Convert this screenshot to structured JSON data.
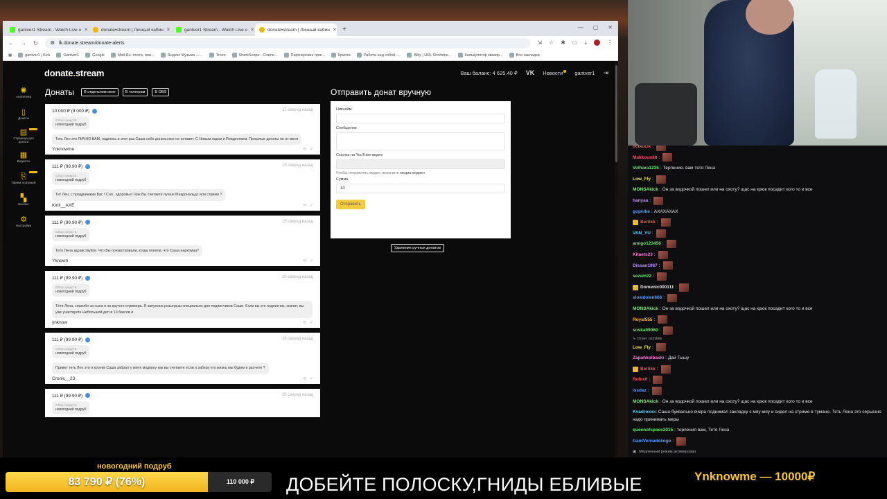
{
  "browser": {
    "tabs": [
      {
        "title": "gantver1 Stream - Watch Live o",
        "fav": "k",
        "active": false
      },
      {
        "title": "donate•stream | Личный кабин",
        "fav": "d",
        "active": false
      },
      {
        "title": "gantver1 Stream - Watch Live o",
        "fav": "k",
        "active": false
      },
      {
        "title": "donate•stream | Личный кабин",
        "fav": "d",
        "active": true
      }
    ],
    "new_tab": "+",
    "url": "lk.donate.stream/donate-alerts",
    "bookmarks": [
      "gantver1 | Kick",
      "Gantver1",
      "Google",
      "Mail.Ru: почта, пои...",
      "Яндекс Музыка —...",
      "Trovo",
      "SharkScope - Crame...",
      "Партнерские прог...",
      "Крипта",
      "Работа над собой -...",
      "Bitly | URL Shortene...",
      "Калькулятор квазор...",
      "Все закладки"
    ]
  },
  "site": {
    "logo_pre": "donate",
    "logo_dot": ".",
    "logo_post": "stream",
    "balance": "Ваш баланс: 4 625.40 ₽",
    "vk": "VK",
    "news": "Новости",
    "user": "gantver1",
    "logout": "⇥"
  },
  "sidebar": [
    {
      "label": "Аналитика",
      "icon": "✺",
      "badge": false
    },
    {
      "label": "Донаты",
      "icon": "▯",
      "badge": false
    },
    {
      "label": "Страница для доната",
      "icon": "▤",
      "badge": true
    },
    {
      "label": "Виджеты",
      "icon": "▦",
      "badge": false
    },
    {
      "label": "Приём платежей",
      "icon": "⎘",
      "badge": true
    },
    {
      "label": "Баланс",
      "icon": "▚",
      "badge": false
    },
    {
      "label": "Настройки",
      "icon": "⚙",
      "badge": false
    }
  ],
  "donations": {
    "title": "Донаты",
    "btn_window": "В отдельном окне",
    "btn_telegram": "В телеграм",
    "btn_obs": "В OBS",
    "items": [
      {
        "amount": "10 000 ₽ (9 000 ₽)",
        "time": "17 секунд назад",
        "goal_label": "Сбор средств",
        "goal": "новогодний подруб",
        "message": "Теть Лен это ЛИЧНО ВАМ, надеюсь в этот раз Саша себе донаты все не оставит. С Новым годом и Рождеством. Прошлые донаты не от меня",
        "name": "Ynknowme"
      },
      {
        "amount": "111 ₽ (99.90 ₽)",
        "time": "15 секунд назад",
        "goal_label": "Сбор средств",
        "goal": "новогодний подруб",
        "message": "Тет Лен, с праздниками Вас ! Сап , здоровья ! Как Вы считаете лучше Макдональдс или стрими ?",
        "name": "Kirill__AXE"
      },
      {
        "amount": "111 ₽ (99.90 ₽)",
        "time": "15 секунд назад",
        "goal_label": "Сбор средств",
        "goal": "новогодний подруб",
        "message": "Тетя Лена здравствуйте. Что Вы почувствовали, когда поняли, что Саша наркоман?",
        "name": "Yknown"
      },
      {
        "amount": "111 ₽ (99.90 ₽)",
        "time": "20 секунд назад",
        "goal_label": "Сбор средств",
        "goal": "новогодний подруб",
        "message": "Тётя Лена, спасибо за сына и за крутого стримера. Я запускаю розыгрыш специально для подписчиков Саши. Если вы его подписчик, значит, вы уже участвуете.Небольшой деп в 10 баксов и",
        "name": "ynknow"
      },
      {
        "amount": "111 ₽ (99.90 ₽)",
        "time": "16 секунд назад",
        "goal_label": "Сбор средств",
        "goal": "новогодний подруб",
        "message": "Привет теть Лен это я кроник Саша забрал у меня модерку как вы считаете если я заберу его жизнь мы будем в расчете ?",
        "name": "Cronic__23"
      },
      {
        "amount": "111 ₽ (99.90 ₽)",
        "time": "20 секунд назад",
        "goal_label": "Сбор средств",
        "goal": "новогодний подруб",
        "message": "",
        "name": ""
      }
    ]
  },
  "manual": {
    "title": "Отправить донат вручную",
    "nickname_label": "Никнейм",
    "message_label": "Сообщение",
    "youtube_label": "Ссылка на YouTube-видео",
    "youtube_hint": "Чтобы отправлять видео, включите",
    "youtube_hint_link": "медиа-виджет",
    "amount_label": "Сумма",
    "amount_value": "10",
    "send_label": "Отправить",
    "delete_label": "Удаление ручных донатов"
  },
  "chat": {
    "messages": [
      {
        "user": "octkocik",
        "color": "#ff5f5f",
        "text": "",
        "emote": true
      },
      {
        "user": "Makkoun88",
        "color": "#ff4f6a",
        "text": "",
        "emote": true
      },
      {
        "user": "Volhara1235",
        "color": "#5ff05f",
        "text": "Терпение. вам тетя Лена",
        "emote": false
      },
      {
        "user": "Low_Fly",
        "color": "#e8e85a",
        "text": "",
        "emote": true
      },
      {
        "user": "MONSAkick",
        "color": "#7cf07c",
        "text": "Он за водочкой пошел или на охоту? щас на крюк посадит кого то и все",
        "emote": false
      },
      {
        "user": "hanyaa",
        "color": "#c08cff",
        "text": "",
        "emote": true
      },
      {
        "user": "gopnike",
        "color": "#5aa0ff",
        "text": "AXAXAXAX",
        "emote": false
      },
      {
        "user": "Berlikk",
        "color": "#ff4f4f",
        "text": "",
        "emote": true,
        "badge": true
      },
      {
        "user": "VAN_YU",
        "color": "#5ad0ff",
        "text": "",
        "emote": true
      },
      {
        "user": "amigo123456",
        "color": "#5ff05f",
        "text": "",
        "emote": true
      },
      {
        "user": "Kitaets23",
        "color": "#ff7ae0",
        "text": "",
        "emote": true
      },
      {
        "user": "Dissan1987",
        "color": "#c08cff",
        "text": "",
        "emote": true
      },
      {
        "user": "sezam22",
        "color": "#5ff05f",
        "text": "",
        "emote": true
      },
      {
        "user": "Domenic000111",
        "color": "#e6e6e6",
        "text": "",
        "emote": true,
        "badge": true
      },
      {
        "user": "slowdown666",
        "color": "#5aa0ff",
        "text": "",
        "emote": true
      },
      {
        "user": "MONSAkick",
        "color": "#7cf07c",
        "text": "Он за водочкой пошел или на охоту? щас на крюк посадит кого то и все",
        "emote": false
      },
      {
        "user": "Royal555",
        "color": "#ffb43a",
        "text": "",
        "emote": true
      },
      {
        "user": "soska99060",
        "color": "#5ff05f",
        "text": "",
        "emote": true
      },
      {
        "user": "Low_Fly",
        "color": "#e8e85a",
        "text": "",
        "emote": true
      },
      {
        "user": "Zapahkolbaski",
        "color": "#ff7ae0",
        "text": "Дай Тышу",
        "emote": false
      },
      {
        "user": "Berlikk",
        "color": "#ff4f4f",
        "text": "",
        "emote": true,
        "badge": true
      },
      {
        "user": "Rolex0",
        "color": "#ff4f4f",
        "text": "",
        "emote": true
      },
      {
        "user": "issdaz",
        "color": "#5aa0ff",
        "text": "",
        "emote": true
      },
      {
        "user": "MONSAkick",
        "color": "#7cf07c",
        "text": "Он за водочкой пошел или на охоту? щас на крюк посадит кого то и все",
        "emote": false
      },
      {
        "user": "Kvadroxxx",
        "color": "#5ad0ff",
        "text": "Саша буквально вчера поднимал закладку с мяу-мяу и сидел на стриме в тумане. Теть Лена это серьезно надо принимать меры",
        "emote": false,
        "wrap": true
      },
      {
        "user": "queenofspace2015",
        "color": "#5ff05f",
        "text": "терпения вам, Тетя Лена",
        "emote": false
      },
      {
        "user": "GantVernadskogo",
        "color": "#5aa0ff",
        "text": "",
        "emote": true
      }
    ],
    "reply_text": "↳ Ответ olchikkk",
    "slow_mode": "Медленный режим активирован"
  },
  "overlay": {
    "goal_title": "новогодний подруб",
    "goal_current": "83 790 ₽ (76%)",
    "goal_target": "110 000 ₽",
    "goal_progress": 0.76,
    "caption": "ДОБЕЙТЕ ПОЛОСКУ,ГНИДЫ ЕБЛИВЫЕ",
    "last_donor": "Ynknowme — 10000₽"
  }
}
